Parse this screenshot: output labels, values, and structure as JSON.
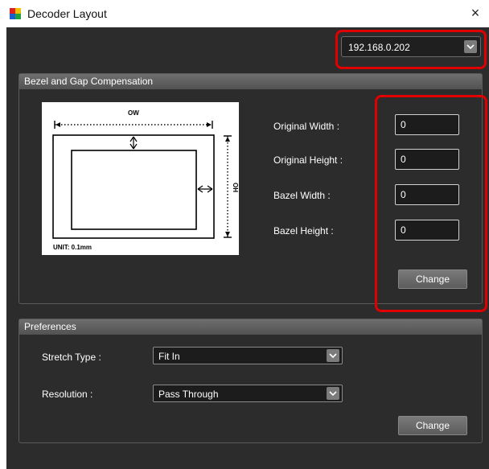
{
  "window": {
    "title": "Decoder Layout",
    "close_glyph": "×"
  },
  "device_select": {
    "value": "192.168.0.202",
    "icon": "chevron-down-icon"
  },
  "bezel_group": {
    "title": "Bezel and Gap Compensation",
    "diagram": {
      "ow_label": "OW",
      "oh_label": "OH",
      "unit_label": "UNIT: 0.1mm"
    },
    "fields": [
      {
        "label": "Original Width :",
        "value": "0"
      },
      {
        "label": "Original Height :",
        "value": "0"
      },
      {
        "label": "Bazel Width :",
        "value": "0"
      },
      {
        "label": "Bazel Height :",
        "value": "0"
      }
    ],
    "change_label": "Change"
  },
  "preferences_group": {
    "title": "Preferences",
    "stretch_type": {
      "label": "Stretch Type :",
      "value": "Fit In"
    },
    "resolution": {
      "label": "Resolution :",
      "value": "Pass Through"
    },
    "change_label": "Change"
  },
  "colors": {
    "highlight": "#e00000",
    "panel": "#2c2c2c",
    "header": "#5e5e5e"
  }
}
